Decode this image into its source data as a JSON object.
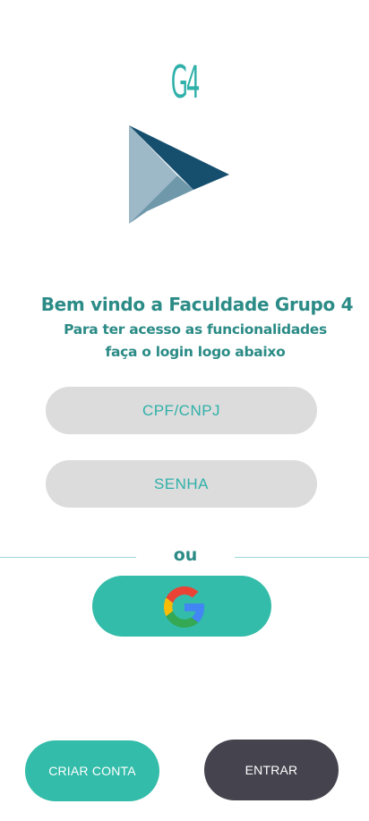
{
  "brand": {
    "mark": "G4"
  },
  "welcome": {
    "title": "Bem vindo a  Faculdade Grupo 4",
    "subtitle_line1": "Para ter acesso as funcionalidades",
    "subtitle_line2": "faça o login logo abaixo"
  },
  "form": {
    "cpf_placeholder": "CPF/CNPJ",
    "password_placeholder": "SENHA"
  },
  "divider": {
    "text": "ou"
  },
  "social": {
    "google_icon": "google-icon"
  },
  "actions": {
    "create_account_label": "CRIAR CONTA",
    "enter_label": "ENTRAR"
  },
  "colors": {
    "accent": "#33bca9",
    "text_teal": "#2b8b86",
    "input_bg": "#dcdcdc",
    "dark_button": "#45434d",
    "logo_dark": "#164f6e",
    "logo_mid": "#6f98ab",
    "logo_light": "#9db8c6"
  }
}
